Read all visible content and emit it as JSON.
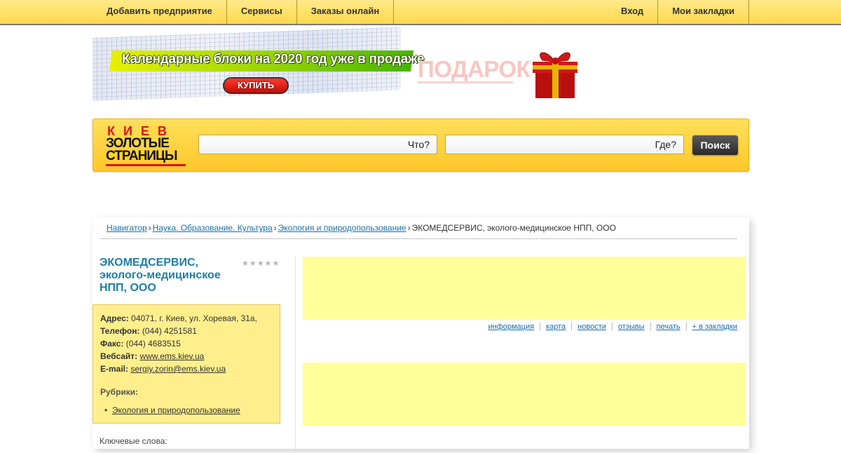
{
  "topnav": {
    "left": [
      "Добавить предприятие",
      "Сервисы",
      "Заказы онлайн"
    ],
    "right": [
      "Вход",
      "Мои закладки"
    ]
  },
  "banner": {
    "headline": "Календарные блоки на 2020 год уже в продаже",
    "buy_label": "КУПИТЬ",
    "gift_label": "ПОДАРОК"
  },
  "logo": {
    "city": "КИЕВ",
    "line1": "ЗОЛОТЫЕ",
    "line2": "СТРАНИЦЫ"
  },
  "search": {
    "what_label": "Что?",
    "where_label": "Где?",
    "button_label": "Поиск"
  },
  "breadcrumb": {
    "items": [
      "Навигатор",
      "Наука. Образование. Культура",
      "Экология и природопользование"
    ],
    "current": "ЭКОМЕДСЕРВИС, эколого-медицинское НПП, ООО",
    "separator": "›"
  },
  "company": {
    "title": "ЭКОМЕДСЕРВИС, эколого-медицинское НПП, ООО",
    "rating_stars": "★★★★★",
    "address_label": "Адрес:",
    "address": "04071, г. Киев, ул. Хоревая, 31а,",
    "phone_label": "Телефон:",
    "phone": "(044) 4251581",
    "fax_label": "Факс:",
    "fax": "(044) 4683515",
    "website_label": "Вебсайт:",
    "website": "www.ems.kiev.ua",
    "email_label": "E-mail:",
    "email": "sergiy.zorin@ems.kiev.ua",
    "rubrics_label": "Рубрики:",
    "rubric": "Экология и природопользование",
    "keywords_label": "Ключевые слова:"
  },
  "tabs": [
    "информация",
    "карта",
    "новости",
    "отзывы",
    "печать",
    "+ в закладки"
  ],
  "colors": {
    "nav_bg": "#ffd84a",
    "accent_blue": "#1d7ea8",
    "info_box_bg": "#ffef8c",
    "ad_bg": "#ffff99",
    "logo_red": "#e0121d"
  }
}
